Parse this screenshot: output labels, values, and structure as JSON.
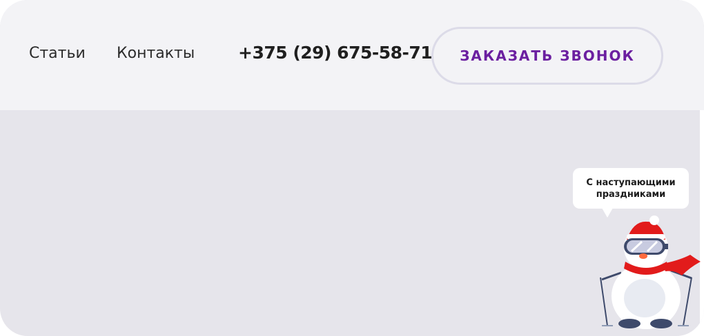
{
  "header": {
    "nav": [
      {
        "label": "Статьи"
      },
      {
        "label": "Контакты"
      }
    ],
    "phone": "+375 (29) 675-58-71",
    "callback_label": "ЗАКАЗАТЬ ЗВОНОК"
  },
  "greeting": {
    "line1": "С наступающими",
    "line2": "праздниками"
  },
  "colors": {
    "accent": "#6b1fa0",
    "header_bg": "#f3f3f6",
    "content_bg": "#e6e5eb"
  },
  "icons": [
    "snowman-skier-icon"
  ]
}
